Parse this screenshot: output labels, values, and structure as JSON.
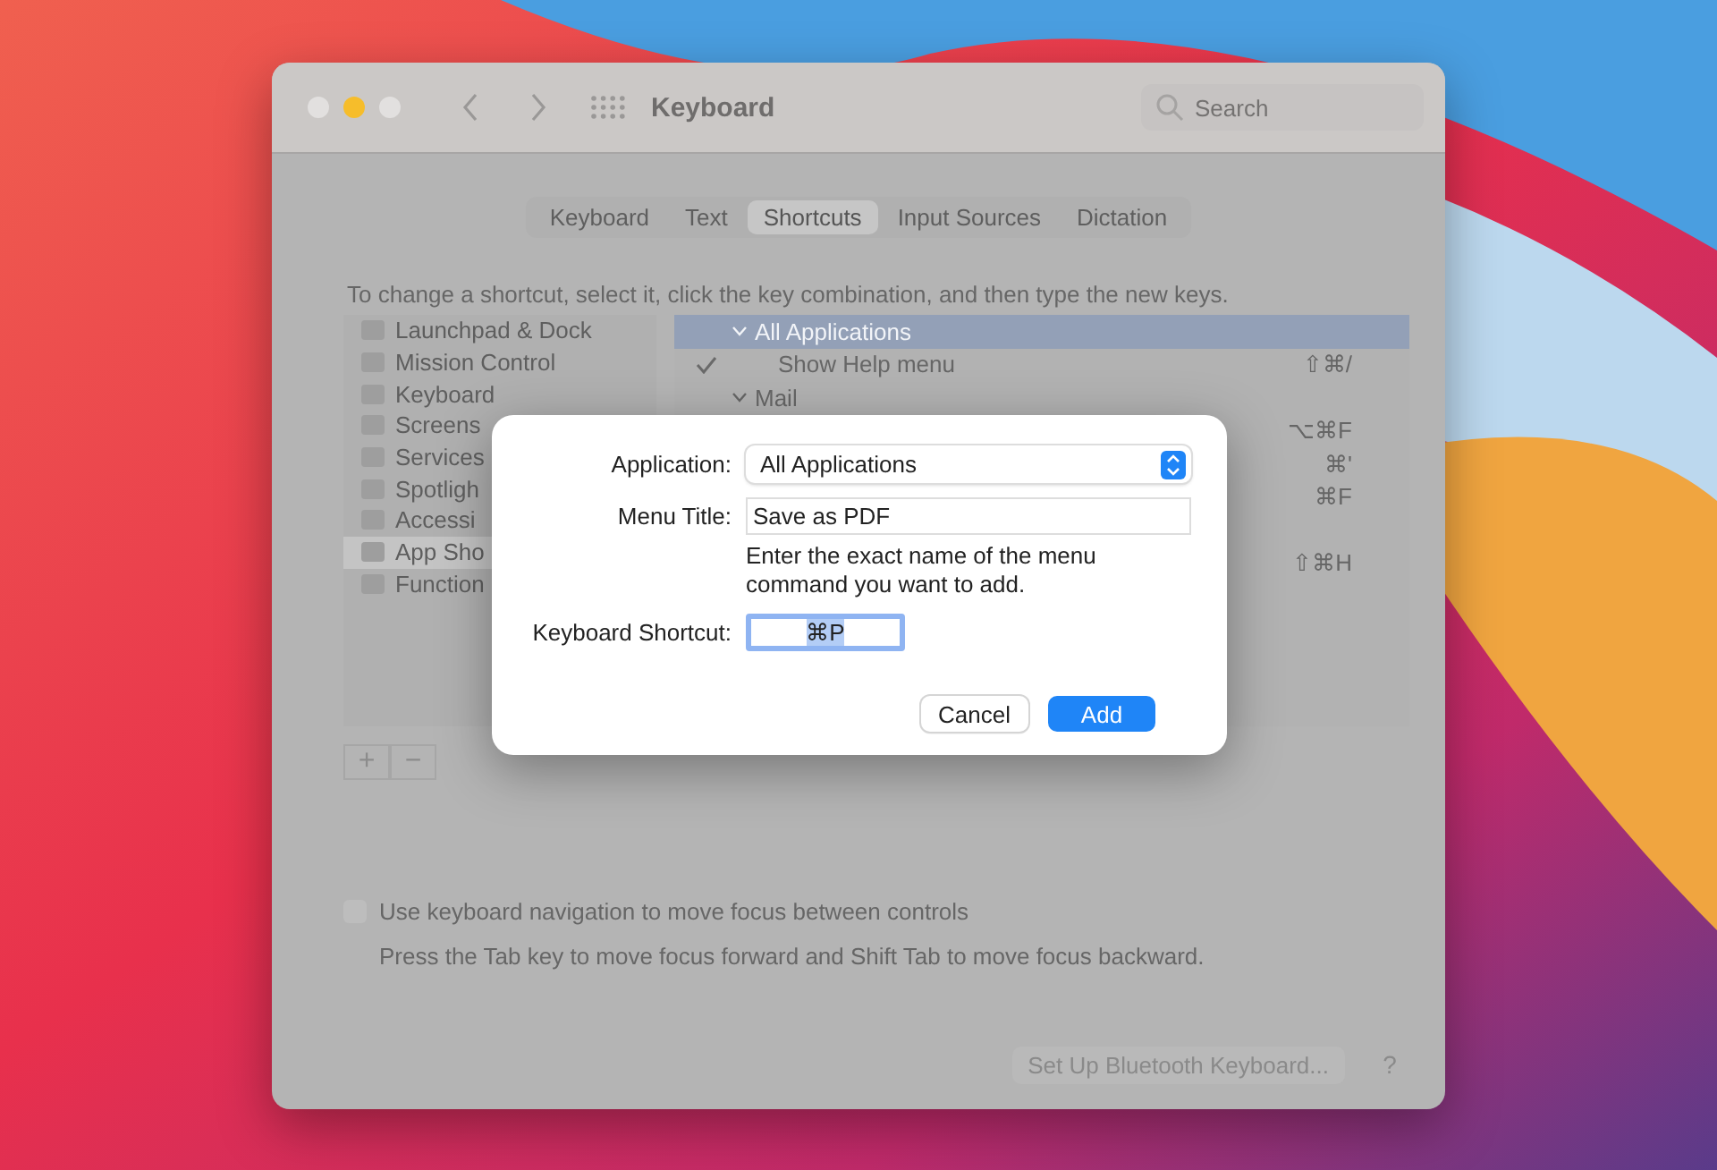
{
  "window": {
    "title": "Keyboard",
    "search": {
      "placeholder": "Search"
    }
  },
  "tabs": [
    {
      "label": "Keyboard",
      "selected": false
    },
    {
      "label": "Text",
      "selected": false
    },
    {
      "label": "Shortcuts",
      "selected": true
    },
    {
      "label": "Input Sources",
      "selected": false
    },
    {
      "label": "Dictation",
      "selected": false
    }
  ],
  "instruction": "To change a shortcut, select it, click the key combination, and then type the new keys.",
  "sidebar": {
    "items": [
      {
        "label": "Launchpad & Dock",
        "selected": false
      },
      {
        "label": "Mission Control",
        "selected": false
      },
      {
        "label": "Keyboard",
        "selected": false
      },
      {
        "label": "Screens",
        "selected": false
      },
      {
        "label": "Services",
        "selected": false
      },
      {
        "label": "Spotligh",
        "selected": false
      },
      {
        "label": "Accessi",
        "selected": false
      },
      {
        "label": "App Sho",
        "selected": true
      },
      {
        "label": "Function",
        "selected": false
      }
    ]
  },
  "shortcuts": [
    {
      "kind": "group",
      "label": "All Applications",
      "expanded": true,
      "selected": true
    },
    {
      "kind": "item",
      "label": "Show Help menu",
      "checked": true,
      "keys": "⇧⌘/"
    },
    {
      "kind": "group",
      "label": "Mail",
      "expanded": true,
      "selected": false
    },
    {
      "kind": "item",
      "keys": "⌥⌘F"
    },
    {
      "kind": "item",
      "keys": "⌘'"
    },
    {
      "kind": "item",
      "keys": "⌘F"
    },
    {
      "kind": "item"
    },
    {
      "kind": "item",
      "keys": "⇧⌘H"
    }
  ],
  "list_buttons": [
    "+",
    "−"
  ],
  "keyboard_navigation": {
    "label": "Use keyboard navigation to move focus between controls",
    "checked": false,
    "hint": "Press the Tab key to move focus forward and Shift Tab to move focus backward."
  },
  "bluetooth_button": "Set Up Bluetooth Keyboard...",
  "help_button": "?",
  "dialog": {
    "application_label": "Application:",
    "application_value": "All Applications",
    "menu_title_label": "Menu Title:",
    "menu_title_value": "Save as PDF",
    "menu_title_hint": "Enter the exact name of the menu command you want to add.",
    "shortcut_label": "Keyboard Shortcut:",
    "shortcut_value": "⌘P",
    "buttons": [
      {
        "label": "Cancel",
        "kind": "secondary"
      },
      {
        "label": "Add",
        "kind": "primary"
      }
    ]
  }
}
